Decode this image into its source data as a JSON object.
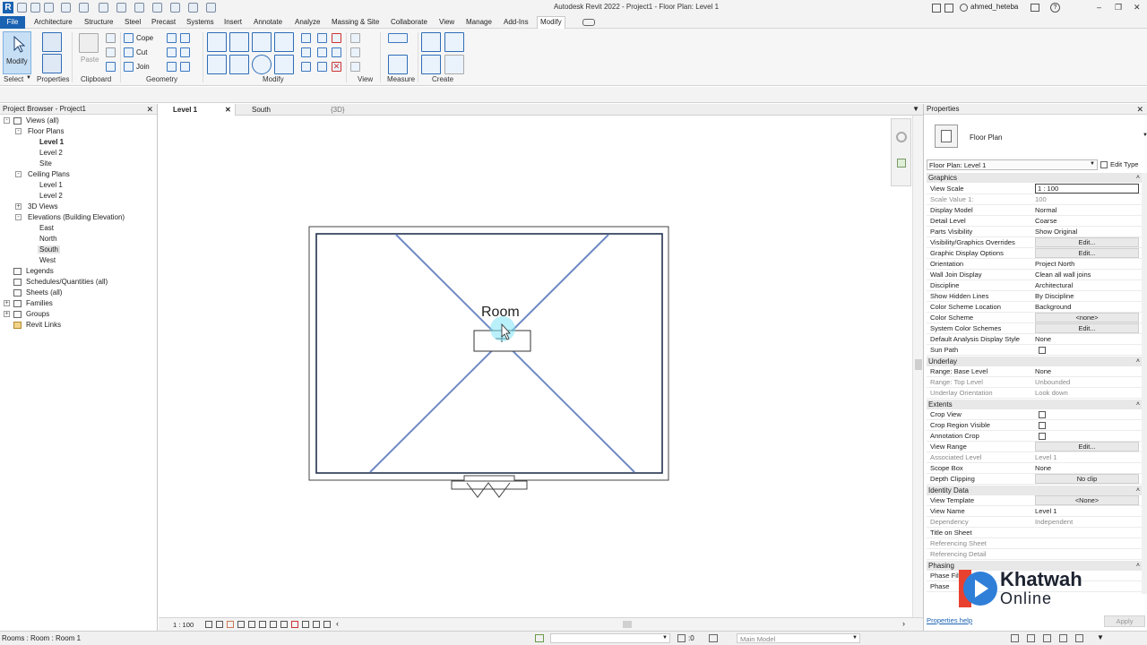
{
  "title_bar": {
    "title": "Autodesk Revit 2022 - Project1 - Floor Plan: Level 1",
    "user": "ahmed_heteba"
  },
  "menu_tabs": [
    "File",
    "Architecture",
    "Structure",
    "Steel",
    "Precast",
    "Systems",
    "Insert",
    "Annotate",
    "Analyze",
    "Massing & Site",
    "Collaborate",
    "View",
    "Manage",
    "Add-Ins",
    "Modify"
  ],
  "ribbon": {
    "modify_label": "Modify",
    "paste_label": "Paste",
    "cope_label": "Cope",
    "cut_label": "Cut",
    "join_label": "Join",
    "groups": {
      "select": "Select",
      "properties": "Properties",
      "clipboard": "Clipboard",
      "geometry": "Geometry",
      "modify": "Modify",
      "view": "View",
      "measure": "Measure",
      "create": "Create"
    }
  },
  "project_browser": {
    "title": "Project Browser - Project1",
    "items": [
      {
        "label": "Views (all)"
      },
      {
        "label": "Floor Plans"
      },
      {
        "label": "Level 1"
      },
      {
        "label": "Level 2"
      },
      {
        "label": "Site"
      },
      {
        "label": "Ceiling Plans"
      },
      {
        "label": "Level 1"
      },
      {
        "label": "Level 2"
      },
      {
        "label": "3D Views"
      },
      {
        "label": "Elevations (Building Elevation)"
      },
      {
        "label": "East"
      },
      {
        "label": "North"
      },
      {
        "label": "South"
      },
      {
        "label": "West"
      },
      {
        "label": "Legends"
      },
      {
        "label": "Schedules/Quantities (all)"
      },
      {
        "label": "Sheets (all)"
      },
      {
        "label": "Families"
      },
      {
        "label": "Groups"
      },
      {
        "label": "Revit Links"
      }
    ]
  },
  "view_tabs": [
    "Level 1",
    "South",
    "{3D}"
  ],
  "canvas": {
    "room_label": "Room"
  },
  "view_control": {
    "scale": "1 : 100"
  },
  "properties": {
    "title": "Properties",
    "type_name": "Floor Plan",
    "selector": "Floor Plan: Level 1",
    "edit_type": "Edit Type",
    "sections": {
      "graphics": "Graphics",
      "underlay": "Underlay",
      "extents": "Extents",
      "identity": "Identity Data",
      "phasing": "Phasing"
    },
    "rows": {
      "view_scale": {
        "name": "View Scale",
        "value": "1 : 100"
      },
      "scale_value": {
        "name": "Scale Value    1:",
        "value": "100"
      },
      "display_model": {
        "name": "Display Model",
        "value": "Normal"
      },
      "detail_level": {
        "name": "Detail Level",
        "value": "Coarse"
      },
      "parts_visibility": {
        "name": "Parts Visibility",
        "value": "Show Original"
      },
      "vg_overrides": {
        "name": "Visibility/Graphics Overrides",
        "value": "Edit..."
      },
      "graphic_display": {
        "name": "Graphic Display Options",
        "value": "Edit..."
      },
      "orientation": {
        "name": "Orientation",
        "value": "Project North"
      },
      "wall_join": {
        "name": "Wall Join Display",
        "value": "Clean all wall joins"
      },
      "discipline": {
        "name": "Discipline",
        "value": "Architectural"
      },
      "hidden_lines": {
        "name": "Show Hidden Lines",
        "value": "By Discipline"
      },
      "color_scheme_loc": {
        "name": "Color Scheme Location",
        "value": "Background"
      },
      "color_scheme": {
        "name": "Color Scheme",
        "value": "<none>"
      },
      "system_color": {
        "name": "System Color Schemes",
        "value": "Edit..."
      },
      "analysis_style": {
        "name": "Default Analysis Display Style",
        "value": "None"
      },
      "sun_path": {
        "name": "Sun Path",
        "value": ""
      },
      "base_level": {
        "name": "Range: Base Level",
        "value": "None"
      },
      "top_level": {
        "name": "Range: Top Level",
        "value": "Unbounded"
      },
      "underlay_orient": {
        "name": "Underlay Orientation",
        "value": "Look down"
      },
      "crop_view": {
        "name": "Crop View",
        "value": ""
      },
      "crop_region": {
        "name": "Crop Region Visible",
        "value": ""
      },
      "annotation_crop": {
        "name": "Annotation Crop",
        "value": ""
      },
      "view_range": {
        "name": "View Range",
        "value": "Edit..."
      },
      "assoc_level": {
        "name": "Associated Level",
        "value": "Level 1"
      },
      "scope_box": {
        "name": "Scope Box",
        "value": "None"
      },
      "depth_clipping": {
        "name": "Depth Clipping",
        "value": "No clip"
      },
      "view_template": {
        "name": "View Template",
        "value": "<None>"
      },
      "view_name": {
        "name": "View Name",
        "value": "Level 1"
      },
      "dependency": {
        "name": "Dependency",
        "value": "Independent"
      },
      "title_on_sheet": {
        "name": "Title on Sheet",
        "value": ""
      },
      "ref_sheet": {
        "name": "Referencing Sheet",
        "value": ""
      },
      "ref_detail": {
        "name": "Referencing Detail",
        "value": ""
      },
      "phase_filter": {
        "name": "Phase Filter",
        "value": ""
      },
      "phase": {
        "name": "Phase",
        "value": ""
      }
    },
    "help_link": "Properties help",
    "apply_label": "Apply"
  },
  "status_bar": {
    "message": "Rooms : Room : Room 1",
    "worksets": ":0",
    "model": "Main Model"
  },
  "watermark": {
    "line1": "Khatwah",
    "line2": "Online"
  },
  "colors": {
    "revit_blue": "#1a62b2",
    "room_line": "#6f89c4",
    "wall_line": "#23324f"
  }
}
